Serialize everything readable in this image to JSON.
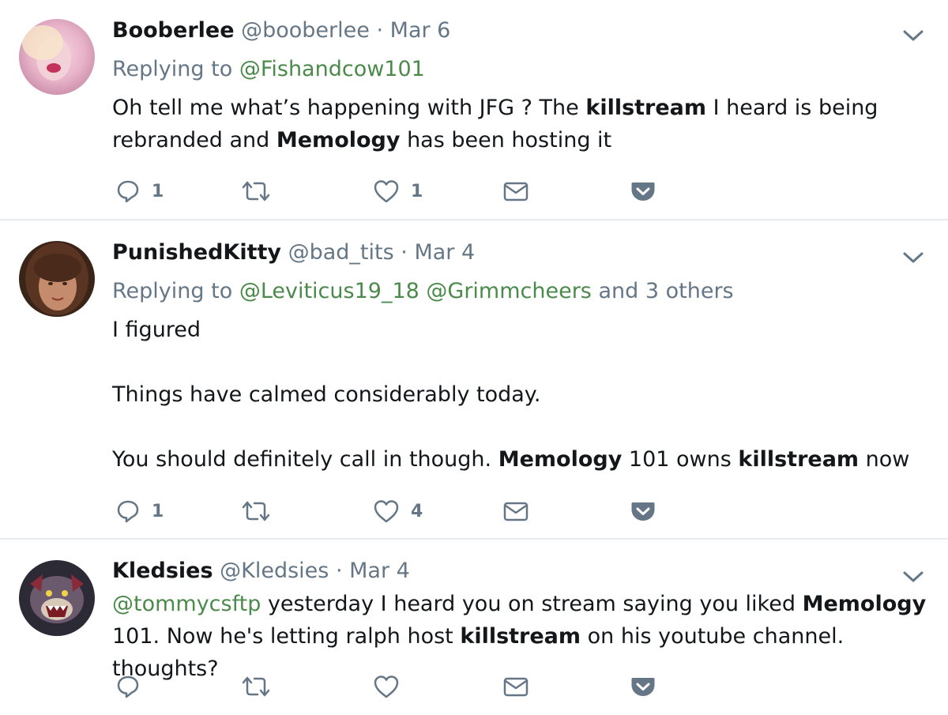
{
  "tweets": [
    {
      "name": "Booberlee",
      "handle": "@booberlee",
      "date": "Mar 6",
      "replying_prefix": "Replying to",
      "replying_mentions": [
        "@Fishandcow101"
      ],
      "replying_suffix": "",
      "text_parts": [
        "Oh tell me what’s happening with JFG ? The ",
        "killstream",
        " I heard is being rebranded and ",
        "Memology",
        " has been hosting it"
      ],
      "replies": "1",
      "retweets": "",
      "likes": "1"
    },
    {
      "name": "PunishedKitty",
      "handle": "@bad_tits",
      "date": "Mar 4",
      "replying_prefix": "Replying to",
      "replying_mentions": [
        "@Leviticus19_18",
        "@Grimmcheers"
      ],
      "replying_suffix": "and 3 others",
      "text_lines": [
        "I figured",
        "Things have calmed considerably today."
      ],
      "text_parts": [
        "You should definitely call in though. ",
        "Memology",
        " 101 owns ",
        "killstream",
        " now"
      ],
      "replies": "1",
      "retweets": "",
      "likes": "4"
    },
    {
      "name": "Kledsies",
      "handle": "@Kledsies",
      "date": "Mar 4",
      "mention": "@tommycsftp",
      "text_parts": [
        " yesterday I heard you on stream saying you liked ",
        "Memology",
        " 101. Now he's letting ralph host ",
        "killstream",
        " on his youtube channel. thoughts?"
      ],
      "replies": "",
      "retweets": "",
      "likes": ""
    }
  ],
  "separator": "·",
  "colors": {
    "name": "#14171a",
    "meta": "#657786",
    "mention": "#4b8a4b",
    "divider": "#e6ecf0",
    "icon": "#657786"
  },
  "icons": [
    "reply-icon",
    "retweet-icon",
    "like-icon",
    "direct-message-icon",
    "pocket-icon",
    "chevron-down-icon"
  ]
}
